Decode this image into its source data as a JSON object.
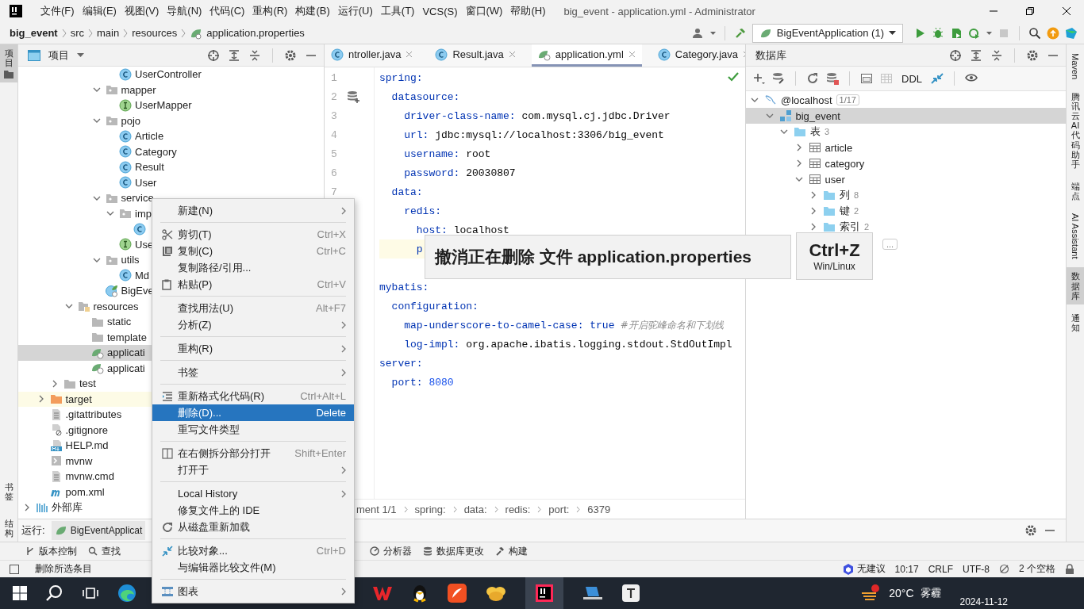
{
  "menubar": {
    "items": [
      "文件(F)",
      "编辑(E)",
      "视图(V)",
      "导航(N)",
      "代码(C)",
      "重构(R)",
      "构建(B)",
      "运行(U)",
      "工具(T)",
      "VCS(S)",
      "窗口(W)",
      "帮助(H)"
    ],
    "title": "big_event - application.yml - Administrator"
  },
  "navbar": {
    "breadcrumb": [
      "big_event",
      "src",
      "main",
      "resources",
      "application.properties"
    ],
    "run_config": "BigEventApplication (1)"
  },
  "left_stripe": [
    {
      "label": "项目",
      "selected": true
    },
    {
      "label": "书签",
      "selected": false
    },
    {
      "label": "结构",
      "selected": false
    }
  ],
  "right_stripe": [
    {
      "label": "Maven",
      "kind": "latin",
      "selected": false
    },
    {
      "label": "腾讯云 AI 代码助手",
      "kind": "cjk",
      "selected": false
    },
    {
      "label": "端点",
      "kind": "cjk",
      "selected": false
    },
    {
      "label": "AI Assistant",
      "kind": "latin",
      "selected": false
    },
    {
      "label": "数据库",
      "kind": "cjk",
      "selected": true
    },
    {
      "label": "通知",
      "kind": "cjk",
      "selected": false
    }
  ],
  "project": {
    "title": "项目",
    "tree": [
      {
        "kind": "offscreen",
        "children": [
          {
            "kind": "offscreen",
            "children": [
              {
                "kind": "offscreen",
                "children": [
                  {
                    "kind": "offscreen",
                    "children": [
                      {
                        "kind": "offscreen",
                        "children": [
                          {
                            "kind": "offscreen",
                            "children": [
                              {
                                "label": "UserController",
                                "kind": "class",
                                "selected": false
                              }
                            ]
                          },
                          {
                            "label": "mapper",
                            "kind": "package",
                            "expanded": true,
                            "selected": false,
                            "children": [
                              {
                                "label": "UserMapper",
                                "kind": "interface",
                                "selected": false
                              }
                            ]
                          },
                          {
                            "label": "pojo",
                            "kind": "package",
                            "expanded": true,
                            "selected": false,
                            "children": [
                              {
                                "label": "Article",
                                "kind": "class",
                                "selected": false
                              },
                              {
                                "label": "Category",
                                "kind": "class",
                                "selected": false
                              },
                              {
                                "label": "Result",
                                "kind": "class",
                                "selected": false
                              },
                              {
                                "label": "User",
                                "kind": "class",
                                "selected": false
                              }
                            ]
                          },
                          {
                            "label": "service",
                            "kind": "package",
                            "expanded": true,
                            "selected": false,
                            "children": [
                              {
                                "label": "imp",
                                "kind": "package",
                                "expanded": true,
                                "selected": false,
                                "children": [
                                  {
                                    "kind": "class",
                                    "selected": false
                                  }
                                ]
                              },
                              {
                                "label": "Use",
                                "kind": "interface",
                                "selected": false
                              }
                            ]
                          },
                          {
                            "label": "utils",
                            "kind": "package",
                            "expanded": true,
                            "selected": false,
                            "children": [
                              {
                                "label": "Md",
                                "kind": "class",
                                "selected": false
                              }
                            ]
                          },
                          {
                            "label": "BigEve",
                            "kind": "spring-app",
                            "selected": false
                          }
                        ]
                      }
                    ]
                  },
                  {
                    "label": "resources",
                    "kind": "resources",
                    "expanded": true,
                    "selected": false,
                    "children": [
                      {
                        "label": "static",
                        "kind": "folder",
                        "selected": false
                      },
                      {
                        "label": "template",
                        "kind": "folder",
                        "selected": false
                      },
                      {
                        "label": "applicati",
                        "kind": "spring-config",
                        "selected": true
                      },
                      {
                        "label": "applicati",
                        "kind": "spring-config",
                        "selected": false
                      }
                    ]
                  }
                ]
              },
              {
                "label": "test",
                "kind": "folder",
                "expanded": false,
                "selected": false
              }
            ]
          },
          {
            "label": "target",
            "kind": "excluded",
            "expanded": false,
            "selected": false
          },
          {
            "label": ".gitattributes",
            "kind": "text",
            "selected": false
          },
          {
            "label": ".gitignore",
            "kind": "ignore",
            "selected": false
          },
          {
            "label": "HELP.md",
            "kind": "markdown",
            "selected": false
          },
          {
            "label": "mvnw",
            "kind": "script",
            "selected": false
          },
          {
            "label": "mvnw.cmd",
            "kind": "text",
            "selected": false
          },
          {
            "label": "pom.xml",
            "kind": "maven",
            "selected": false
          }
        ]
      },
      {
        "label": "外部库",
        "kind": "library",
        "expanded": false,
        "selected": false
      }
    ]
  },
  "editor": {
    "tabs": [
      {
        "label": "ntroller.java",
        "kind": "class",
        "selected": false
      },
      {
        "label": "Result.java",
        "kind": "class",
        "selected": false
      },
      {
        "label": "application.yml",
        "kind": "spring-config",
        "selected": true
      },
      {
        "label": "Category.java",
        "kind": "class",
        "selected": false
      }
    ],
    "lines": [
      {
        "kind": "key",
        "number": "1",
        "key": "spring:"
      },
      {
        "kind": "key",
        "number": "2",
        "key": "  datasource:"
      },
      {
        "kind": "string",
        "number": "3",
        "key": "    driver-class-name:",
        "value": "com.mysql.cj.jdbc.Driver"
      },
      {
        "kind": "string",
        "number": "4",
        "key": "    url:",
        "value": "jdbc:mysql://localhost:3306/big_event"
      },
      {
        "kind": "string",
        "number": "5",
        "key": "    username:",
        "value": "root"
      },
      {
        "kind": "string",
        "number": "6",
        "key": "    password:",
        "value": "20030807"
      },
      {
        "kind": "key",
        "number": "7",
        "key": "  data:"
      },
      {
        "kind": "key",
        "key": "    redis:"
      },
      {
        "kind": "string",
        "key": "      host:",
        "value": "localhost"
      },
      {
        "kind": "key",
        "key": "      p",
        "current": true
      },
      {
        "kind": "blank"
      },
      {
        "kind": "key",
        "key": "mybatis:"
      },
      {
        "kind": "key",
        "key": "  configuration:"
      },
      {
        "kind": "keyword",
        "key": "    map-underscore-to-camel-case:",
        "value": "true",
        "comment": "#开启驼峰命名和下划线"
      },
      {
        "kind": "string",
        "key": "    log-impl:",
        "value": "org.apache.ibatis.logging.stdout.StdOutImpl"
      },
      {
        "kind": "key",
        "key": "server:"
      },
      {
        "kind": "number",
        "key": "  port:",
        "value": "8080"
      }
    ],
    "breadcrumb": [
      "ment 1/1",
      "spring:",
      "data:",
      "redis:",
      "port:",
      "6379"
    ]
  },
  "database": {
    "title": "数据库",
    "toolbar_text": "DDL",
    "tree": [
      {
        "label": "@localhost",
        "kind": "server",
        "badge": "1/17",
        "expanded": true,
        "selected": false,
        "children": [
          {
            "label": "big_event",
            "kind": "schema",
            "expanded": true,
            "selected": true,
            "children": [
              {
                "label": "表",
                "count": "3",
                "kind": "folder",
                "expanded": true,
                "selected": false,
                "children": [
                  {
                    "label": "article",
                    "kind": "table",
                    "expanded": false,
                    "selected": false
                  },
                  {
                    "label": "category",
                    "kind": "table",
                    "expanded": false,
                    "selected": false
                  },
                  {
                    "label": "user",
                    "kind": "table",
                    "expanded": true,
                    "selected": false,
                    "children": [
                      {
                        "label": "列",
                        "count": "8",
                        "kind": "folder",
                        "expanded": false,
                        "selected": false
                      },
                      {
                        "label": "键",
                        "count": "2",
                        "kind": "folder",
                        "expanded": false,
                        "selected": false
                      },
                      {
                        "label": "索引",
                        "count": "2",
                        "kind": "folder",
                        "expanded": false,
                        "selected": false
                      }
                    ]
                  }
                ]
              }
            ]
          }
        ]
      }
    ],
    "more_button": "..."
  },
  "context_menu": [
    {
      "label": "新建(N)",
      "submenu": true,
      "selected": false
    },
    {
      "label": "剪切(T)",
      "shortcut": "Ctrl+X",
      "separator_before": true,
      "selected": false
    },
    {
      "label": "复制(C)",
      "shortcut": "Ctrl+C",
      "selected": false
    },
    {
      "label": "复制路径/引用...",
      "selected": false
    },
    {
      "label": "粘贴(P)",
      "shortcut": "Ctrl+V",
      "selected": false
    },
    {
      "label": "查找用法(U)",
      "shortcut": "Alt+F7",
      "separator_before": true,
      "selected": false
    },
    {
      "label": "分析(Z)",
      "submenu": true,
      "selected": false
    },
    {
      "label": "重构(R)",
      "submenu": true,
      "separator_before": true,
      "selected": false
    },
    {
      "label": "书签",
      "submenu": true,
      "separator_before": true,
      "selected": false
    },
    {
      "label": "重新格式化代码(R)",
      "shortcut": "Ctrl+Alt+L",
      "separator_before": true,
      "selected": false
    },
    {
      "label": "删除(D)...",
      "shortcut": "Delete",
      "selected": true
    },
    {
      "label": "重写文件类型",
      "selected": false
    },
    {
      "label": "在右侧拆分部分打开",
      "shortcut": "Shift+Enter",
      "separator_before": true,
      "selected": false
    },
    {
      "label": "打开于",
      "submenu": true,
      "selected": false
    },
    {
      "label": "Local History",
      "submenu": true,
      "separator_before": true,
      "selected": false
    },
    {
      "label": "修复文件上的 IDE",
      "selected": false
    },
    {
      "label": "从磁盘重新加载",
      "selected": false
    },
    {
      "label": "比较对象...",
      "shortcut": "Ctrl+D",
      "separator_before": true,
      "selected": false
    },
    {
      "label": "与编辑器比较文件(M)",
      "selected": false
    },
    {
      "label": "图表",
      "submenu": true,
      "separator_before": true,
      "selected": false
    }
  ],
  "undo_tooltip": {
    "message": "撤消正在删除 文件 application.properties",
    "shortcut": "Ctrl+Z",
    "platform": "Win/Linux"
  },
  "run_bar": {
    "label": "运行:",
    "tab": "BigEventApplicat"
  },
  "tool_tabs": [
    "版本控制",
    "查找",
    "分析器",
    "数据库更改",
    "构建"
  ],
  "status_bar": {
    "message": "删除所选条目",
    "assistant": "无建议",
    "position": "10:17",
    "line_ending": "CRLF",
    "encoding": "UTF-8",
    "indent": "2 个空格"
  },
  "taskbar": {
    "temperature": "20°C",
    "weather": "雾霾",
    "date": "2024-11-12"
  }
}
